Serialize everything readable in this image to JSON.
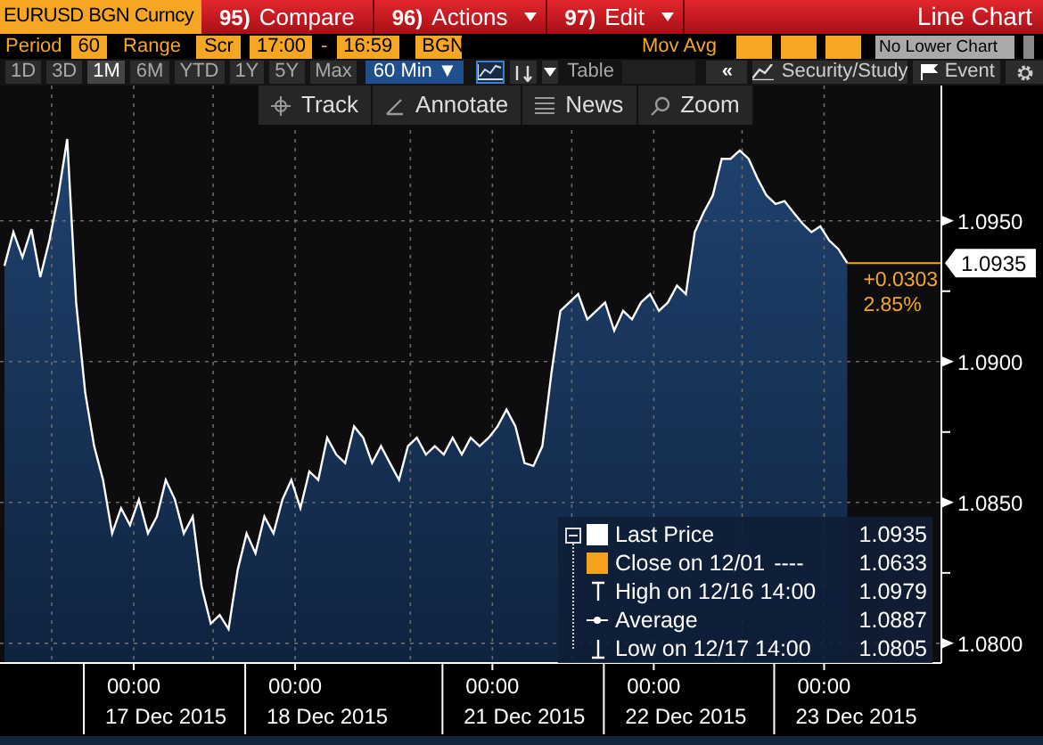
{
  "header": {
    "security": "EURUSD BGN Curncy",
    "menu": [
      {
        "number": "95)",
        "label": "Compare",
        "dropdown": false
      },
      {
        "number": "96)",
        "label": "Actions",
        "dropdown": true
      },
      {
        "number": "97)",
        "label": "Edit",
        "dropdown": true
      }
    ],
    "chart_type": "Line Chart"
  },
  "settings": {
    "period_label": "Period",
    "period": "60",
    "range_label": "Range",
    "range": "Scr",
    "start": "17:00",
    "range_separator": "-",
    "end": "16:59",
    "source": "BGN",
    "mov_avg_label": "Mov Avg",
    "lower_chart": "No Lower Chart"
  },
  "ranges": [
    {
      "label": "1D",
      "selected": false
    },
    {
      "label": "3D",
      "selected": false
    },
    {
      "label": "1M",
      "selected": true
    },
    {
      "label": "6M",
      "selected": false
    },
    {
      "label": "YTD",
      "selected": false
    },
    {
      "label": "1Y",
      "selected": false
    },
    {
      "label": "5Y",
      "selected": false
    },
    {
      "label": "Max",
      "selected": false
    }
  ],
  "interval": "60 Min ▼",
  "tools": {
    "table": "Table",
    "collapse": "«",
    "security_study": "Security/Study",
    "event": "Event"
  },
  "chart_toolbar": [
    {
      "kind": "track",
      "label": "Track"
    },
    {
      "kind": "annotate",
      "label": "Annotate"
    },
    {
      "kind": "news",
      "label": "News"
    },
    {
      "kind": "zoom",
      "label": "Zoom"
    }
  ],
  "chart": {
    "chart_data": {
      "type": "area",
      "ylim": [
        1.0793,
        1.0998
      ],
      "categories": [
        null,
        null,
        null,
        null,
        null,
        null,
        null,
        null,
        null,
        null,
        null,
        null,
        null,
        null,
        null,
        null,
        null,
        null,
        "17 Dec 2015",
        null,
        null,
        null,
        null,
        null,
        null,
        null,
        null,
        null,
        null,
        null,
        null,
        null,
        null,
        null,
        null,
        null,
        "18 Dec 2015",
        null,
        null,
        null,
        null,
        null,
        null,
        null,
        null,
        null,
        null,
        null,
        null,
        null,
        null,
        null,
        null,
        null,
        null,
        null,
        null,
        null,
        "21 Dec 2015",
        null,
        null,
        null,
        null,
        null,
        null,
        null,
        null,
        null,
        null,
        null,
        null,
        null,
        null,
        null,
        null,
        null,
        "22 Dec 2015",
        null,
        null,
        null,
        null,
        null,
        null,
        null,
        null,
        null,
        null,
        null,
        null,
        null,
        null,
        null,
        null,
        null,
        null,
        "23 Dec 2015",
        null,
        null,
        null,
        null,
        null,
        null,
        null,
        null,
        null
      ],
      "series": [
        {
          "name": "Last Price",
          "color": "#ffffff",
          "values": [
            1.0934,
            1.0946,
            1.0937,
            1.0947,
            1.093,
            1.0943,
            1.0959,
            1.0979,
            1.0921,
            1.0889,
            1.087,
            1.0858,
            1.0839,
            1.0848,
            1.0842,
            1.0851,
            1.0839,
            1.0845,
            1.0858,
            1.0851,
            1.0839,
            1.0845,
            1.082,
            1.0807,
            1.081,
            1.0805,
            1.0826,
            1.0839,
            1.0832,
            1.0845,
            1.0839,
            1.0851,
            1.0858,
            1.0848,
            1.0861,
            1.0858,
            1.0873,
            1.0867,
            1.0864,
            1.0877,
            1.0873,
            1.0864,
            1.087,
            1.0864,
            1.0858,
            1.087,
            1.0873,
            1.0867,
            1.087,
            1.0867,
            1.0873,
            1.0867,
            1.0873,
            1.087,
            1.0873,
            1.0877,
            1.0883,
            1.0877,
            1.0864,
            1.0863,
            1.087,
            1.0896,
            1.0918,
            1.0921,
            1.0924,
            1.0915,
            1.0918,
            1.0921,
            1.0911,
            1.0918,
            1.0915,
            1.0921,
            1.0924,
            1.0918,
            1.0921,
            1.0927,
            1.0924,
            1.0946,
            1.0953,
            1.0959,
            1.0972,
            1.0972,
            1.0975,
            1.0972,
            1.0965,
            1.0959,
            1.0956,
            1.0957,
            1.0953,
            1.0949,
            1.0946,
            1.0948,
            1.0943,
            1.094,
            1.0935,
            null,
            null,
            null,
            null,
            null,
            null,
            null,
            null,
            null,
            null
          ]
        }
      ],
      "yticks": [
        {
          "value": 1.08,
          "label": "1.0800"
        },
        {
          "value": 1.085,
          "label": "1.0850"
        },
        {
          "value": 1.09,
          "label": "1.0900"
        },
        {
          "value": 1.095,
          "label": "1.0950"
        }
      ],
      "grid": true
    },
    "x_time_labels": [
      "00:00",
      "00:00",
      "00:00",
      "00:00",
      "00:00"
    ],
    "last_price_label": "1.0935",
    "change": "+0.0303",
    "change_pct": "2.85%"
  },
  "legend": {
    "expanded": true,
    "items": [
      {
        "kind": "series",
        "color": "#ffffff",
        "value": "1.0935"
      },
      {
        "kind": "swatch",
        "color": "#f5a11c",
        "label": "Close on 12/01",
        "dash": "----",
        "value": "1.0633"
      },
      {
        "kind": "high",
        "label": "High on 12/16 14:00",
        "value": "1.0979"
      },
      {
        "kind": "average",
        "label": "Average",
        "value": "1.0887"
      },
      {
        "kind": "low",
        "label": "Low on 12/17 14:00",
        "value": "1.0805"
      }
    ]
  }
}
